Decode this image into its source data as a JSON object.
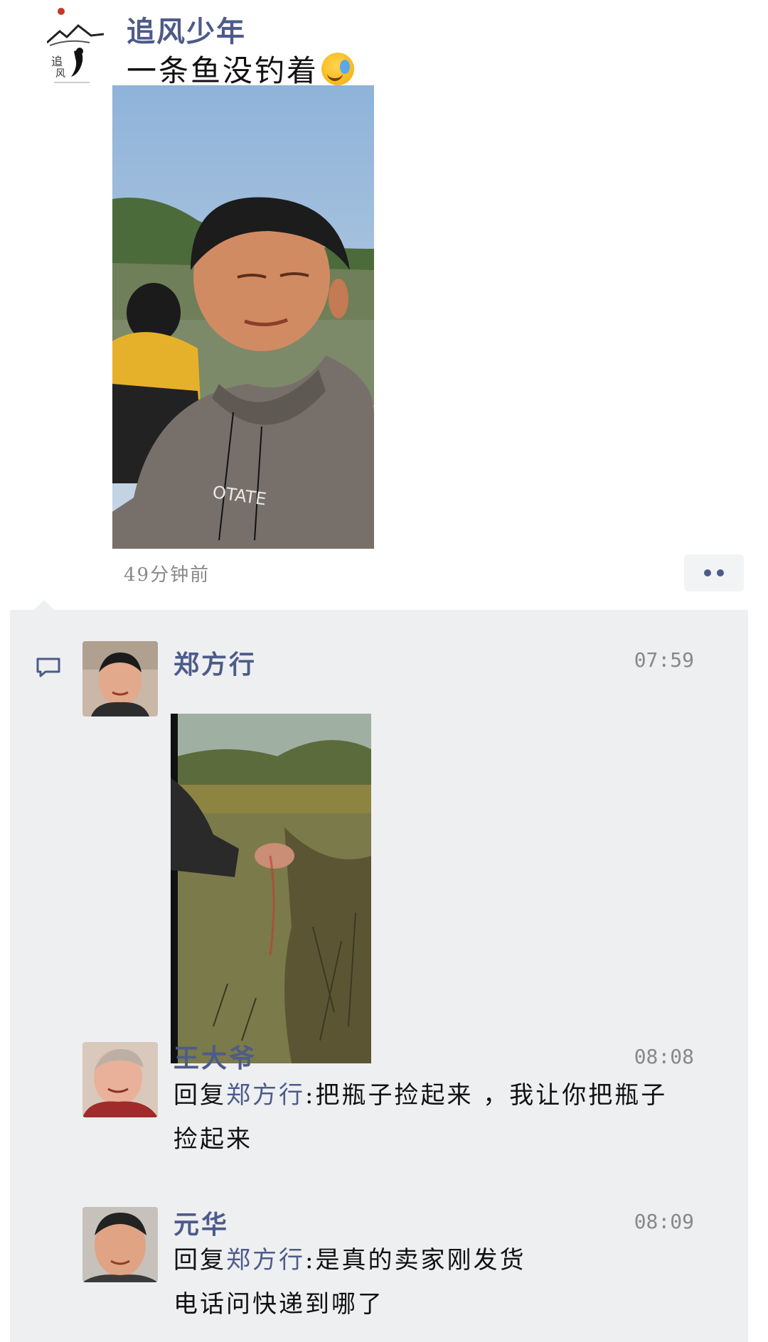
{
  "post": {
    "author": "追风少年",
    "text": "一条鱼没钓着",
    "emoji_icon": "crying-laughing-emoji",
    "photo_alt": "photo-of-man-fishing-by-lake",
    "time": "49分钟前",
    "more_icon": "more-dots-icon"
  },
  "comments": [
    {
      "author": "郑方行",
      "time": "07:59",
      "has_photo": true,
      "photo_alt": "photo-of-hand-over-pond"
    },
    {
      "author": "王大爷",
      "time": "08:08",
      "reply_prefix": "回复",
      "reply_to": "郑方行",
      "text_line1": ":把瓶子捡起来 ，我让你把瓶子",
      "text_line2": "捡起来"
    },
    {
      "author": "元华",
      "time": "08:09",
      "reply_prefix": "回复",
      "reply_to": "郑方行",
      "text_line1": ":是真的卖家刚发货",
      "text_line2": "电话问快递到哪了"
    }
  ],
  "colors": {
    "name": "#4d5b8a",
    "comment_bg": "#eeeff1",
    "time": "#888888"
  }
}
